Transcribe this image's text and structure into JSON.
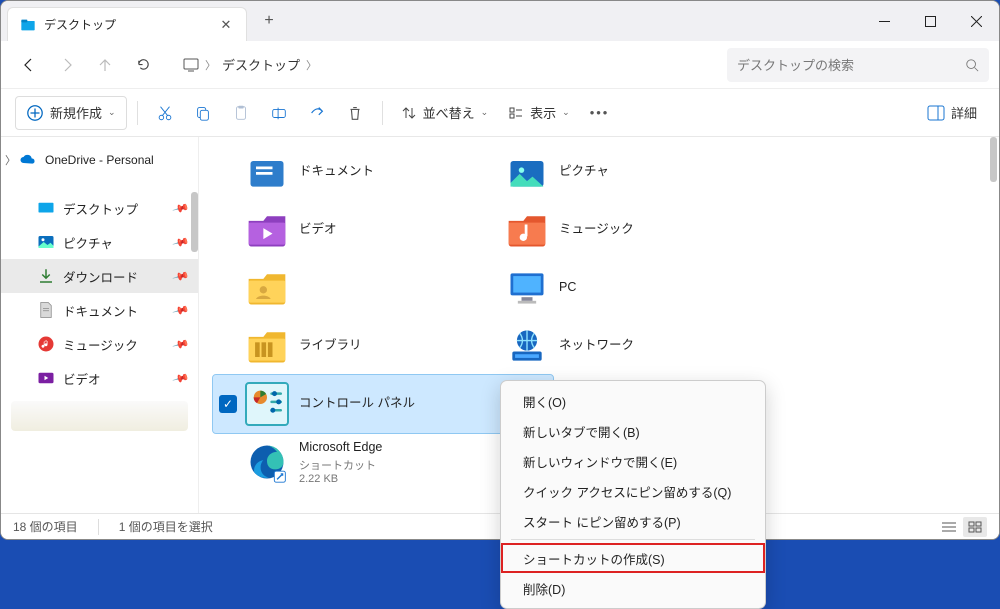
{
  "titlebar": {
    "tab_title": "デスクトップ"
  },
  "breadcrumb": {
    "segments": [
      "デスクトップ"
    ]
  },
  "search": {
    "placeholder": "デスクトップの検索"
  },
  "toolbar": {
    "new_label": "新規作成",
    "sort_label": "並べ替え",
    "view_label": "表示",
    "details_label": "詳細"
  },
  "sidebar": {
    "onedrive": "OneDrive - Personal",
    "items": [
      {
        "label": "デスクトップ"
      },
      {
        "label": "ピクチャ"
      },
      {
        "label": "ダウンロード"
      },
      {
        "label": "ドキュメント"
      },
      {
        "label": "ミュージック"
      },
      {
        "label": "ビデオ"
      }
    ]
  },
  "files": {
    "documents": "ドキュメント",
    "pictures": "ピクチャ",
    "videos": "ビデオ",
    "music": "ミュージック",
    "user_folder": "",
    "pc": "PC",
    "library": "ライブラリ",
    "network": "ネットワーク",
    "control_panel": "コントロール パネル",
    "edge_name": "Microsoft Edge",
    "edge_type": "ショートカット",
    "edge_size": "2.22 KB"
  },
  "context_menu": {
    "items": [
      "開く(O)",
      "新しいタブで開く(B)",
      "新しいウィンドウで開く(E)",
      "クイック アクセスにピン留めする(Q)",
      "スタート にピン留めする(P)",
      "ショートカットの作成(S)",
      "削除(D)"
    ],
    "highlighted_index": 5
  },
  "statusbar": {
    "count": "18 個の項目",
    "selection": "1 個の項目を選択"
  }
}
